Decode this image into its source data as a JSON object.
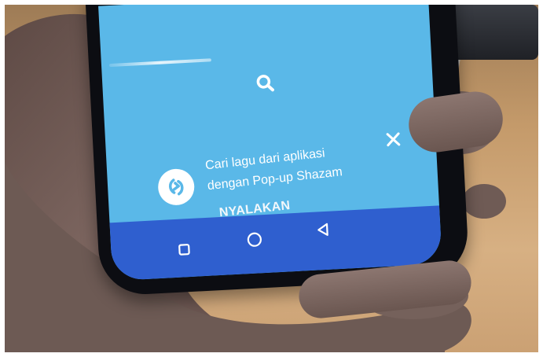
{
  "popup": {
    "line1": "Cari lagu dari aplikasi",
    "line2": "dengan Pop-up Shazam",
    "action_label": "NYALAKAN"
  },
  "icons": {
    "search": "search-icon",
    "close": "close-icon",
    "shazam": "shazam-logo-icon",
    "nav_recents": "square-icon",
    "nav_home": "circle-icon",
    "nav_back": "triangle-back-icon"
  },
  "colors": {
    "screen": "#5ab8e8",
    "navbar": "#2f5fcf",
    "phone": "#0c0d12",
    "desk": "#c49a6a"
  }
}
